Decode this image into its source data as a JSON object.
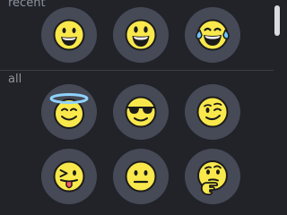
{
  "sections": {
    "recent": {
      "label": "recent"
    },
    "all": {
      "label": "all"
    }
  },
  "emojis": {
    "recent": [
      {
        "name": "grinning-face",
        "icon": "grinning-face-icon"
      },
      {
        "name": "grinning-face-big-eyes",
        "icon": "smiley-icon"
      },
      {
        "name": "face-with-tears-of-joy",
        "icon": "joy-icon"
      }
    ],
    "all": [
      {
        "name": "smiling-face-with-halo",
        "icon": "innocent-icon"
      },
      {
        "name": "smiling-face-with-sunglasses",
        "icon": "sunglasses-icon"
      },
      {
        "name": "winking-face",
        "icon": "wink-icon"
      },
      {
        "name": "winking-face-with-tongue",
        "icon": "stuck-out-tongue-winking-eye-icon"
      },
      {
        "name": "neutral-face",
        "icon": "neutral-face-icon"
      },
      {
        "name": "thinking-face",
        "icon": "thinking-face-icon"
      }
    ]
  },
  "colors": {
    "background": "#212329",
    "button": "#464a57",
    "face": "#f9e84b",
    "outline": "#1b1b1b",
    "label": "#8e939c",
    "halo": "#8fd3ff",
    "tongue": "#ff5b6e",
    "tears": "#6fc3ff",
    "scrollbar": "#d9dbe0"
  }
}
